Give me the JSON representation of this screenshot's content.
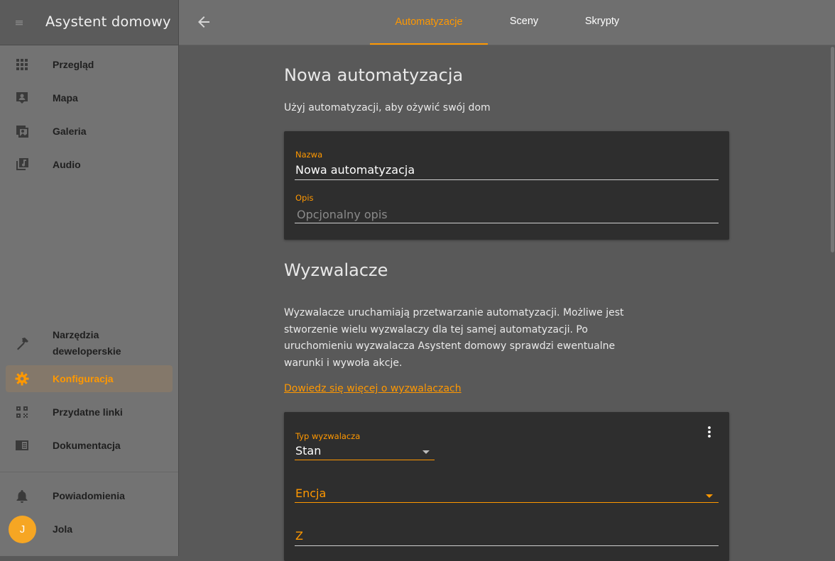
{
  "sidebar": {
    "title": "Asystent domowy",
    "items": [
      {
        "label": "Przegląd",
        "icon": "grid-icon"
      },
      {
        "label": "Mapa",
        "icon": "map-pin-icon"
      },
      {
        "label": "Galeria",
        "icon": "gallery-icon"
      },
      {
        "label": "Audio",
        "icon": "music-library-icon"
      },
      {
        "label": "Narzędzia deweloperskie",
        "icon": "hammer-icon"
      },
      {
        "label": "Konfiguracja",
        "icon": "gear-icon",
        "active": true
      },
      {
        "label": "Przydatne linki",
        "icon": "qr-icon"
      },
      {
        "label": "Dokumentacja",
        "icon": "book-icon"
      },
      {
        "label": "Powiadomienia",
        "icon": "bell-icon"
      }
    ],
    "user": {
      "initial": "J",
      "name": "Jola"
    }
  },
  "topbar": {
    "tabs": [
      {
        "label": "Automatyzacje",
        "active": true
      },
      {
        "label": "Sceny"
      },
      {
        "label": "Skrypty"
      }
    ]
  },
  "main": {
    "title": "Nowa automatyzacja",
    "subtitle": "Użyj automatyzacji, aby ożywić swój dom",
    "name_field": {
      "label": "Nazwa",
      "value": "Nowa automatyzacja"
    },
    "desc_field": {
      "label": "Opis",
      "placeholder": "Opcjonalny opis"
    },
    "triggers": {
      "heading": "Wyzwalacze",
      "description": "Wyzwalacze uruchamiają przetwarzanie automatyzacji. Możliwe jest stworzenie wielu wyzwalaczy dla tej samej automatyzacji. Po uruchomieniu wyzwalacza Asystent domowy sprawdzi ewentualne warunki i wywoła akcje.",
      "learn_more": "Dowiedz się więcej o wyzwalaczach",
      "trigger_type": {
        "label": "Typ wyzwalacza",
        "value": "Stan"
      },
      "entity_label": "Encja",
      "from_label": "Z"
    }
  },
  "colors": {
    "accent": "#ff9800",
    "card": "#2e2e2e",
    "sidebar": "#737373"
  }
}
